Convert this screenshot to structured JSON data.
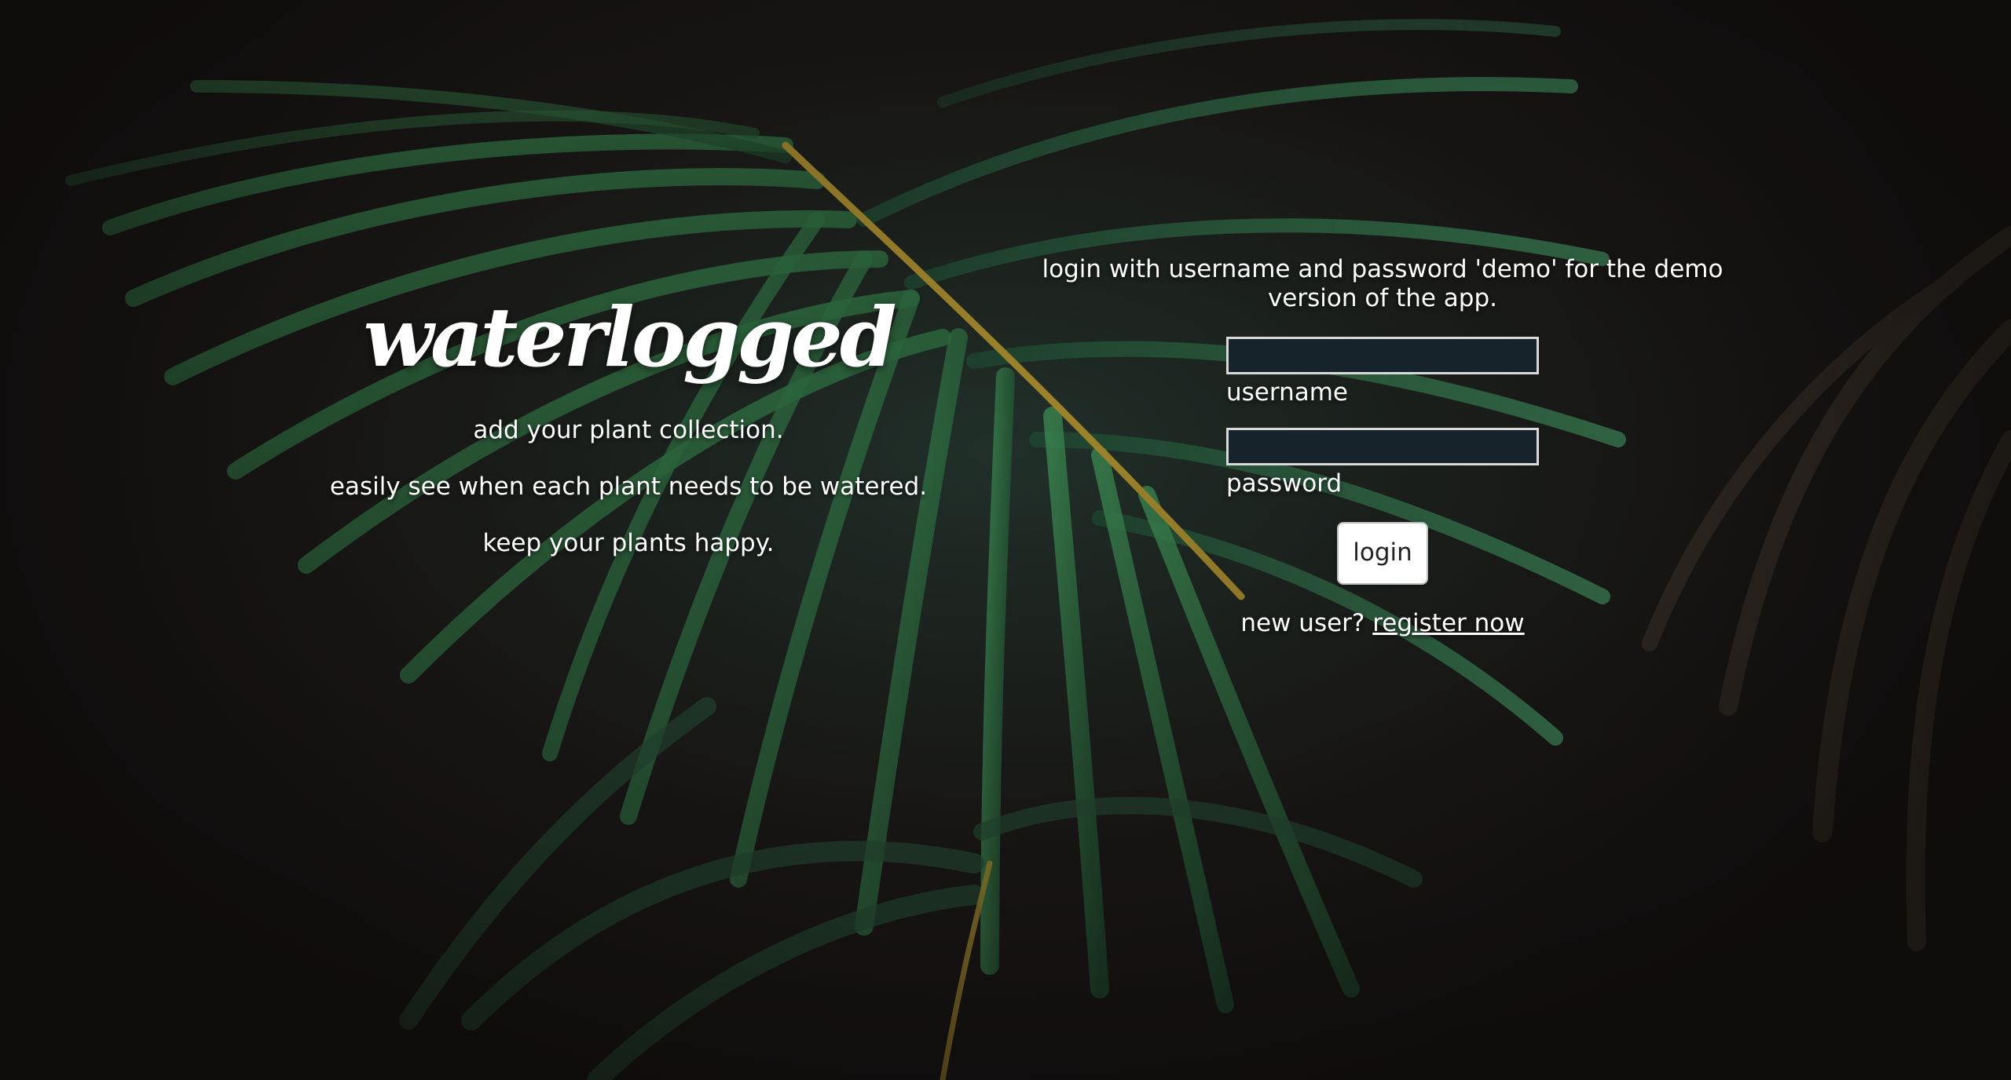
{
  "app": {
    "logo_text": "waterlogged"
  },
  "intro": {
    "taglines": [
      "add your plant collection.",
      "easily see when each plant needs to be watered.",
      "keep your plants happy."
    ]
  },
  "login": {
    "hint": "login with username and password 'demo' for the demo version of the app.",
    "username_label": "username",
    "username_value": "",
    "password_label": "password",
    "password_value": "",
    "button_label": "login",
    "new_user_text": "new user?",
    "register_link": "register now"
  },
  "background": {
    "icon": "palm-leaf-photo",
    "base_color": "#1a1614",
    "leaf_color": "#2f6a3e",
    "stem_color": "#a0862b"
  }
}
